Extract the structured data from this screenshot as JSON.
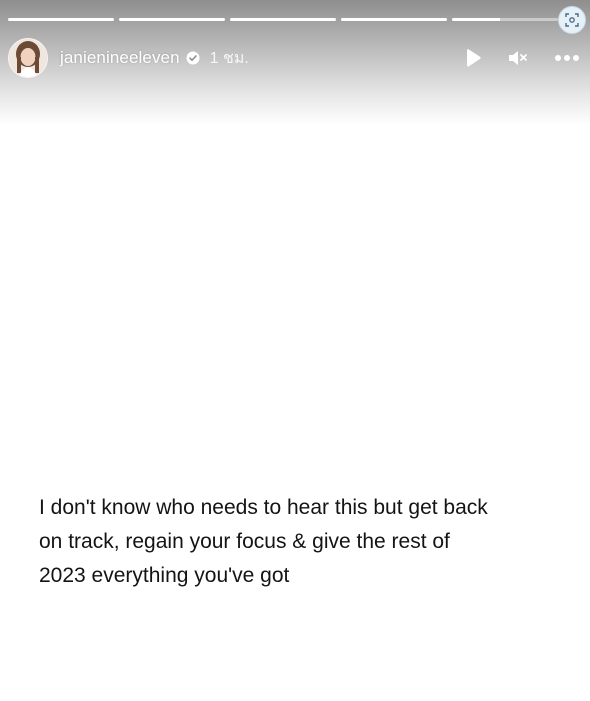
{
  "story": {
    "username": "janienineeleven",
    "time": "1 ชม.",
    "verified": true,
    "progress": [
      1,
      1,
      1,
      1,
      0.45
    ],
    "text": "I don't know who needs to hear this but get back\non track, regain your focus & give the rest of\n2023 everything you've got"
  },
  "icons": {
    "play": "play-icon",
    "mute": "speaker-muted-icon",
    "more": "more-options-icon",
    "corner": "screen-capture-icon",
    "verified": "verified-badge-icon"
  },
  "colors": {
    "text": "#141414",
    "header_text": "#ffffff",
    "background": "#ffffff"
  }
}
